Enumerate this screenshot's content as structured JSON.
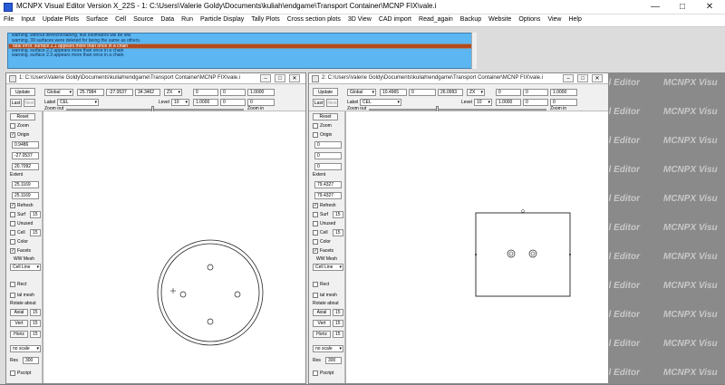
{
  "window": {
    "title": "MCNPX Visual Editor Version X_22S  - 1:  C:\\Users\\Valerie Goldy\\Documents\\kuliah\\endgame\\Transport Container\\MCNP FIX\\vale.i"
  },
  "menu": [
    "File",
    "Input",
    "Update Plots",
    "Surface",
    "Cell",
    "Source",
    "Data",
    "Run",
    "Particle Display",
    "Tally Plots",
    "Cross section plots",
    "3D View",
    "CAD import",
    "Read_again",
    "Backup",
    "Website",
    "Options",
    "View",
    "Help"
  ],
  "messages": [
    "warning.  without lbrench/rdahing, flux estimators will be low.",
    "warning.   39 surfaces were deleted for being the same as others.",
    "fatal error.   surface        2.1 appears more than once in a chain",
    "warning.  surface         2.2 appears more than once in a chain",
    "warning.  surface         2.3 appears more than once in a chain"
  ],
  "background_label": "MCNPX Visual Editor",
  "background_tokens": [
    "al Editor",
    "MCNPX Visu"
  ],
  "panel1": {
    "title": "1:  C:\\Users\\Valerie Goldy\\Documents\\kuliah\\endgame\\Transport Container\\MCNP FIX\\vale.i",
    "update": "Update",
    "last": "Last",
    "next": "Next",
    "reset": "Reset",
    "coord_mode": "Global",
    "x": "25.7984",
    "y": "-27.0537",
    "z": "34.3462",
    "plane": "ZX",
    "v1": "0",
    "v2": "0",
    "v3": "1.0000",
    "label_text": "Label",
    "label_mode": "CEL",
    "level_text": "Level",
    "level": "10",
    "w1": "1.0000",
    "w2": "0",
    "w3": "0",
    "zoom_out": "Zoom out",
    "zoom_in": "Zoom in",
    "zoom": "Zoom",
    "origin": "Origin",
    "o1": "0.9486",
    "o2": "-27.0537",
    "o3": "20.7092",
    "extent": "Extent",
    "e1": "25.1169",
    "e2": "25.1169",
    "refresh": "Refresh",
    "surf": "Surf",
    "surf_n": "15",
    "unused": "Unused",
    "cell": "Cell",
    "cell_n": "15",
    "color": "Color",
    "facets": "Facets",
    "ww_mesh": "WW Mesh",
    "cell_line": "Cell Line",
    "rect": "Rect",
    "tal_mesh": "tal mesh",
    "rotate_about": "Rotate about",
    "axial": "Axial",
    "axial_n": "15",
    "vert": "Vert",
    "vert_n": "15",
    "horiz": "Horiz",
    "horiz_n": "15",
    "scale": "no scale",
    "res": "Res",
    "res_n": "300",
    "pscript": "Pscript"
  },
  "panel2": {
    "title": "2:  C:\\Users\\Valerie Goldy\\Documents\\kuliah\\endgame\\Transport Container\\MCNP FIX\\vale.i",
    "update": "Update",
    "last": "Last",
    "next": "Next",
    "reset": "Reset",
    "coord_mode": "Global",
    "x": "10.4965",
    "y": "0",
    "z": "26.0993",
    "plane": "ZX",
    "v1": "0",
    "v2": "0",
    "v3": "1.0000",
    "label_text": "Label",
    "label_mode": "CEL",
    "level_text": "Level",
    "level": "10",
    "w1": "1.0000",
    "w2": "0",
    "w3": "0",
    "zoom_out": "Zoom out",
    "zoom_in": "Zoom in",
    "zoom": "Zoom",
    "origin": "Origin",
    "o1": "0",
    "o2": "0",
    "o3": "0",
    "extent": "Extent",
    "e1": "79.4327",
    "e2": "79.4327",
    "refresh": "Refresh",
    "surf": "Surf",
    "surf_n": "15",
    "unused": "Unused",
    "cell": "Cell",
    "cell_n": "15",
    "color": "Color",
    "facets": "Facets",
    "ww_mesh": "WW Mesh",
    "cell_line": "Cell Line",
    "rect": "Rect",
    "tal_mesh": "tal mesh",
    "rotate_about": "Rotate about",
    "axial": "Axial",
    "axial_n": "15",
    "vert": "Vert",
    "vert_n": "15",
    "horiz": "Horiz",
    "horiz_n": "15",
    "scale": "no scale",
    "res": "Res",
    "res_n": "300",
    "pscript": "Pscript"
  }
}
